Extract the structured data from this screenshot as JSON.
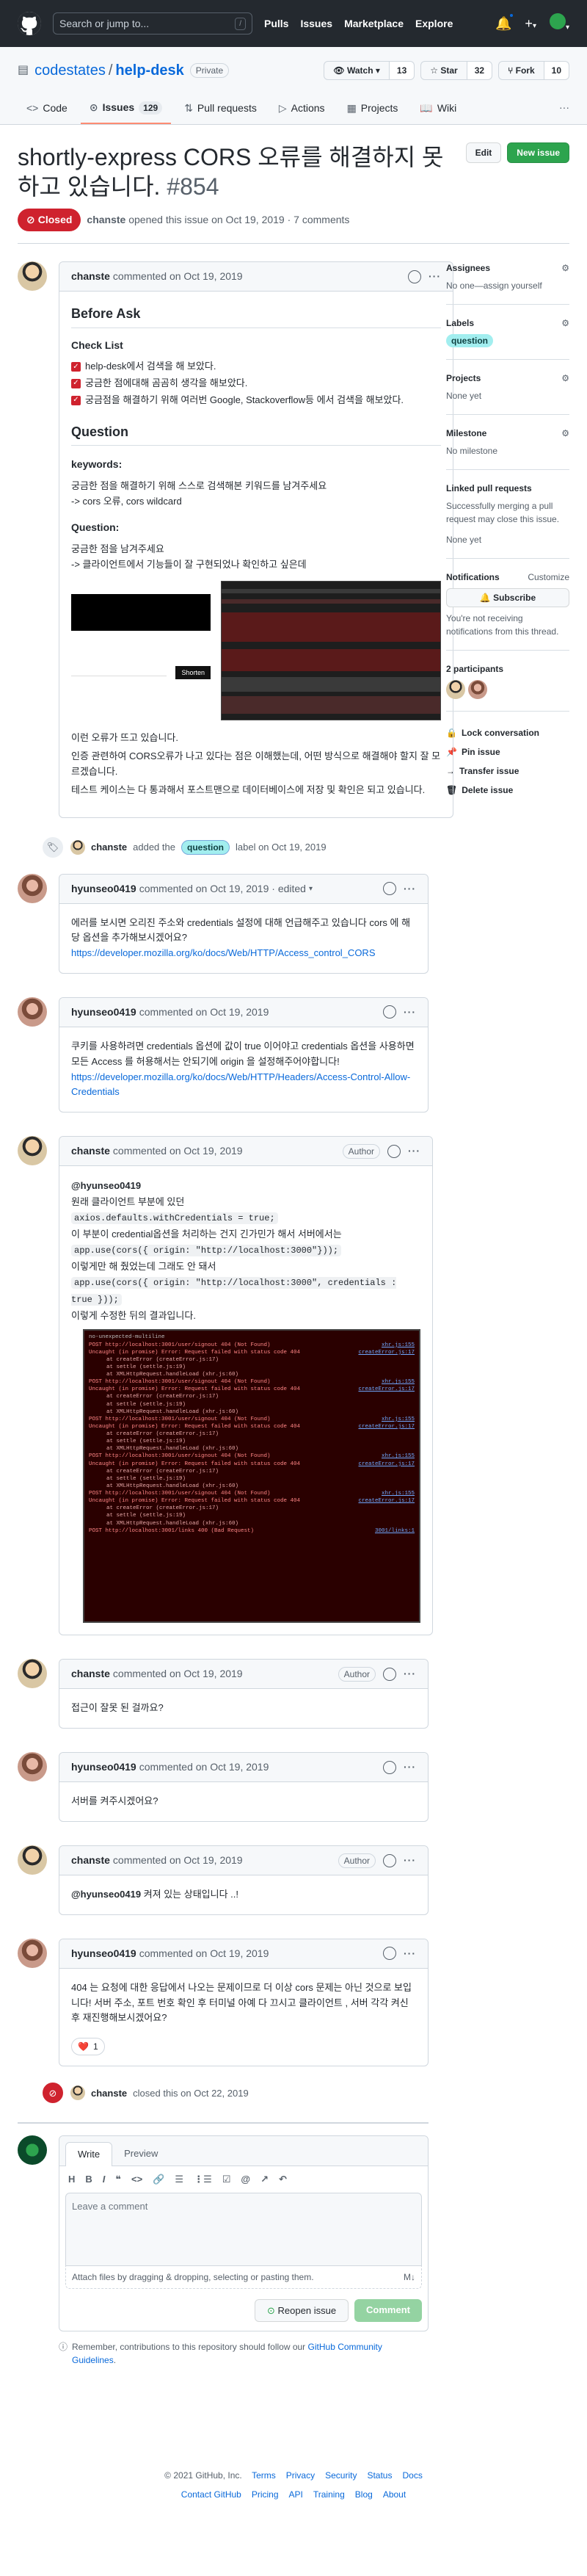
{
  "header": {
    "search_placeholder": "Search or jump to...",
    "search_key": "/",
    "nav": [
      "Pulls",
      "Issues",
      "Marketplace",
      "Explore"
    ],
    "plus": "+",
    "caret": "▾"
  },
  "repo": {
    "owner": "codestates",
    "sep": "/",
    "name": "help-desk",
    "visibility": "Private",
    "watch_label": "Watch",
    "watch_count": "13",
    "star_label": "Star",
    "star_count": "32",
    "fork_label": "Fork",
    "fork_count": "10"
  },
  "tabs": [
    {
      "label": "Code"
    },
    {
      "label": "Issues",
      "count": "129"
    },
    {
      "label": "Pull requests"
    },
    {
      "label": "Actions"
    },
    {
      "label": "Projects"
    },
    {
      "label": "Wiki"
    }
  ],
  "issue": {
    "title": "shortly-express CORS 오류를 해결하지 못하고 있습니다.",
    "number": "#854",
    "edit_label": "Edit",
    "new_issue_label": "New issue",
    "state": "Closed",
    "opener": "chanste",
    "opened_text": "opened this issue on Oct 19, 2019 · 7 comments"
  },
  "first_comment": {
    "author": "chanste",
    "meta": "commented on Oct 19, 2019",
    "h_before_ask": "Before Ask",
    "h_checklist": "Check List",
    "checklist": [
      "help-desk에서 검색을 해 보았다.",
      "궁금한 점에대해 곰곰히 생각을 해보았다.",
      "궁금점을 해결하기 위해 여러번 Google, Stackoverflow등 에서 검색을 해보았다."
    ],
    "h_question": "Question",
    "h_keywords": "keywords:",
    "keywords_text": "궁금한 점을 해결하기 위해 스스로 검색해본 키워드를 남겨주세요",
    "keywords_value": "-> cors 오류, cors wildcard",
    "h_question2": "Question:",
    "question_text": "궁금한 점을 남겨주세요",
    "question_value": "-> 클라이언트에서 기능들이 잘 구현되었나 확인하고 싶은데",
    "shorten_label": "Shorten",
    "para1": "이런 오류가 뜨고 있습니다.",
    "para2": "인증 관련하여 CORS오류가 나고 있다는 점은 이해했는데, 어떤 방식으로 해결해야 할지 잘 모르겠습니다.",
    "para3": "테스트 케이스는 다 통과해서 포스트맨으로 데이터베이스에 저장 및 확인은 되고 있습니다."
  },
  "label_event": {
    "user": "chanste",
    "pre": "added the",
    "label": "question",
    "post": "label on Oct 19, 2019"
  },
  "comments": [
    {
      "author": "hyunseo0419",
      "meta": "commented on Oct 19, 2019 · edited",
      "body": "에러를 보시면 오리진 주소와 credentials 설정에 대해 언급해주고 있습니다 cors 에 해당 옵션을 추가해보시겠어요?",
      "link": "https://developer.mozilla.org/ko/docs/Web/HTTP/Access_control_CORS"
    },
    {
      "author": "hyunseo0419",
      "meta": "commented on Oct 19, 2019",
      "body": "쿠키를 사용하려면 credentials 옵션에 값이 true 이어야고 credentials 옵션을 사용하면 모든 Access 를 허용해서는 안되기에 origin 을 설정해주어야합니다!",
      "link": "https://developer.mozilla.org/ko/docs/Web/HTTP/Headers/Access-Control-Allow-Credentials"
    },
    {
      "author": "chanste",
      "meta": "commented on Oct 19, 2019",
      "badge": "Author",
      "mention": "@hyunseo0419",
      "l1": "원래 클라이언트 부분에 있던",
      "code1": "axios.defaults.withCredentials = true;",
      "l2": "이 부분이 credential옵션을 처리하는 건지 긴가민가 해서 서버에서는",
      "code2": "app.use(cors({ origin: \"http://localhost:3000\"}));",
      "l3": "이렇게만 해 줬었는데 그래도 안 돼서",
      "code3": "app.use(cors({ origin: \"http://localhost:3000\", credentials : true }));",
      "l4": "이렇게 수정한 뒤의 결과입니다.",
      "console_top": "no-unexpected-multiline",
      "console": [
        {
          "t": "POST http://localhost:3001/user/signout 404 (Not Found)",
          "r": "xhr.js:155"
        },
        {
          "t": "Uncaught (in promise) Error: Request failed with status code 404",
          "r": "createError.js:17"
        },
        {
          "t": "at createError (createError.js:17)",
          "i": true
        },
        {
          "t": "at settle (settle.js:19)",
          "i": true
        },
        {
          "t": "at XMLHttpRequest.handleLoad (xhr.js:60)",
          "i": true
        },
        {
          "t": "POST http://localhost:3001/user/signout 404 (Not Found)",
          "r": "xhr.js:155"
        },
        {
          "t": "Uncaught (in promise) Error: Request failed with status code 404",
          "r": "createError.js:17"
        },
        {
          "t": "at createError (createError.js:17)",
          "i": true
        },
        {
          "t": "at settle (settle.js:19)",
          "i": true
        },
        {
          "t": "at XMLHttpRequest.handleLoad (xhr.js:60)",
          "i": true
        },
        {
          "t": "POST http://localhost:3001/user/signout 404 (Not Found)",
          "r": "xhr.js:155"
        },
        {
          "t": "Uncaught (in promise) Error: Request failed with status code 404",
          "r": "createError.js:17"
        },
        {
          "t": "at createError (createError.js:17)",
          "i": true
        },
        {
          "t": "at settle (settle.js:19)",
          "i": true
        },
        {
          "t": "at XMLHttpRequest.handleLoad (xhr.js:60)",
          "i": true
        },
        {
          "t": "POST http://localhost:3001/user/signout 404 (Not Found)",
          "r": "xhr.js:155"
        },
        {
          "t": "Uncaught (in promise) Error: Request failed with status code 404",
          "r": "createError.js:17"
        },
        {
          "t": "at createError (createError.js:17)",
          "i": true
        },
        {
          "t": "at settle (settle.js:19)",
          "i": true
        },
        {
          "t": "at XMLHttpRequest.handleLoad (xhr.js:60)",
          "i": true
        },
        {
          "t": "POST http://localhost:3001/user/signout 404 (Not Found)",
          "r": "xhr.js:155"
        },
        {
          "t": "Uncaught (in promise) Error: Request failed with status code 404",
          "r": "createError.js:17"
        },
        {
          "t": "at createError (createError.js:17)",
          "i": true
        },
        {
          "t": "at settle (settle.js:19)",
          "i": true
        },
        {
          "t": "at XMLHttpRequest.handleLoad (xhr.js:60)",
          "i": true
        },
        {
          "t": "POST http://localhost:3001/links 400 (Bad Request)",
          "r": "3001/links:1"
        }
      ]
    },
    {
      "author": "chanste",
      "meta": "commented on Oct 19, 2019",
      "badge": "Author",
      "body": "접근이 잘못 된 걸까요?"
    },
    {
      "author": "hyunseo0419",
      "meta": "commented on Oct 19, 2019",
      "body": "서버를 켜주시겠어요?"
    },
    {
      "author": "chanste",
      "meta": "commented on Oct 19, 2019",
      "badge": "Author",
      "mention": "@hyunseo0419",
      "body": "켜져 있는 상태입니다 ..!"
    },
    {
      "author": "hyunseo0419",
      "meta": "commented on Oct 19, 2019",
      "body": "404 는 요청에 대한 응답에서 나오는 문제이므로 더 이상 cors 문제는 아닌 것으로 보입니다! 서버 주소, 포트 번호 확인 후 터미널 아예 다 끄시고 클라이언트 , 서버 각각 켜신 후 재진행해보시겠어요?",
      "reaction_emoji": "❤️",
      "reaction_count": "1"
    }
  ],
  "closed_event": {
    "user": "chanste",
    "text": "closed this on Oct 22, 2019"
  },
  "new_comment": {
    "write": "Write",
    "preview": "Preview",
    "toolbar": [
      "H",
      "B",
      "I",
      "❝",
      "<>",
      "🔗",
      "☰",
      "⋮☰",
      "☑",
      "@",
      "↗",
      "↶"
    ],
    "placeholder": "Leave a comment",
    "attach": "Attach files by dragging & dropping, selecting or pasting them.",
    "md": "M↓",
    "reopen": "Reopen issue",
    "comment": "Comment",
    "remember_pre": "Remember, contributions to this repository should follow our",
    "remember_link": "GitHub Community Guidelines",
    "remember_post": "."
  },
  "sidebar": {
    "assignees_title": "Assignees",
    "assignees_value": "No one—assign yourself",
    "labels_title": "Labels",
    "label": "question",
    "projects_title": "Projects",
    "projects_value": "None yet",
    "milestone_title": "Milestone",
    "milestone_value": "No milestone",
    "linked_title": "Linked pull requests",
    "linked_text": "Successfully merging a pull request may close this issue.",
    "linked_value": "None yet",
    "notif_title": "Notifications",
    "notif_customize": "Customize",
    "subscribe": "Subscribe",
    "notif_text": "You're not receiving notifications from this thread.",
    "participants": "2 participants",
    "lock": "Lock conversation",
    "pin": "Pin issue",
    "transfer": "Transfer issue",
    "delete": "Delete issue"
  },
  "footer": {
    "copyright": "© 2021 GitHub, Inc.",
    "links1": [
      "Terms",
      "Privacy",
      "Security",
      "Status",
      "Docs"
    ],
    "links2": [
      "Contact GitHub",
      "Pricing",
      "API",
      "Training",
      "Blog",
      "About"
    ]
  },
  "colors": {
    "closed": "#cf222e",
    "green": "#2da44e",
    "link": "#0969da",
    "label_question": "#a2eeef",
    "header_bg": "#24292f"
  }
}
